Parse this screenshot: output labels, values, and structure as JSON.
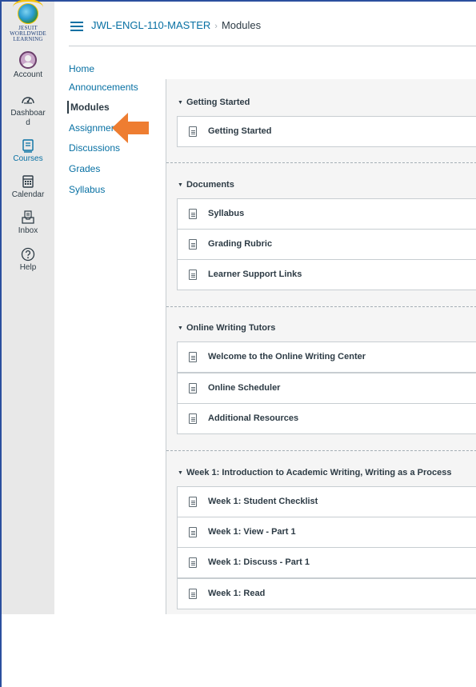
{
  "global_nav": {
    "logo_text": [
      "JESUIT",
      "WORLDWIDE",
      "LEARNING"
    ],
    "items": [
      {
        "label": "Account",
        "icon": "account-avatar-icon"
      },
      {
        "label": "Dashboar\nd",
        "icon": "dashboard-gauge-icon"
      },
      {
        "label": "Courses",
        "icon": "courses-book-icon",
        "active": true
      },
      {
        "label": "Calendar",
        "icon": "calendar-icon"
      },
      {
        "label": "Inbox",
        "icon": "inbox-icon"
      },
      {
        "label": "Help",
        "icon": "help-circle-icon"
      }
    ]
  },
  "header": {
    "course": "JWL-ENGL-110-MASTER",
    "separator": "›",
    "page": "Modules"
  },
  "course_nav": {
    "items": [
      {
        "label": "Home"
      },
      {
        "label": "Announcements"
      },
      {
        "label": "Modules",
        "active": true
      },
      {
        "label": "Assignments"
      },
      {
        "label": "Discussions"
      },
      {
        "label": "Grades"
      },
      {
        "label": "Syllabus"
      }
    ]
  },
  "modules": [
    {
      "title": "Getting Started",
      "items": [
        "Getting Started"
      ]
    },
    {
      "title": "Documents",
      "items": [
        "Syllabus",
        "Grading Rubric",
        "Learner Support Links"
      ]
    },
    {
      "title": "Online Writing Tutors",
      "items": [
        "Welcome to the Online Writing Center",
        "Online Scheduler",
        "Additional Resources"
      ]
    },
    {
      "title": "Week 1: Introduction to Academic Writing, Writing as a Process",
      "items": [
        "Week 1: Student Checklist",
        "Week 1: View - Part 1",
        "Week 1: Discuss - Part 1",
        "Week 1: Read"
      ]
    }
  ],
  "colors": {
    "link": "#0770a3",
    "arrow": "#ee7d31",
    "frame": "#2b4f9e"
  }
}
